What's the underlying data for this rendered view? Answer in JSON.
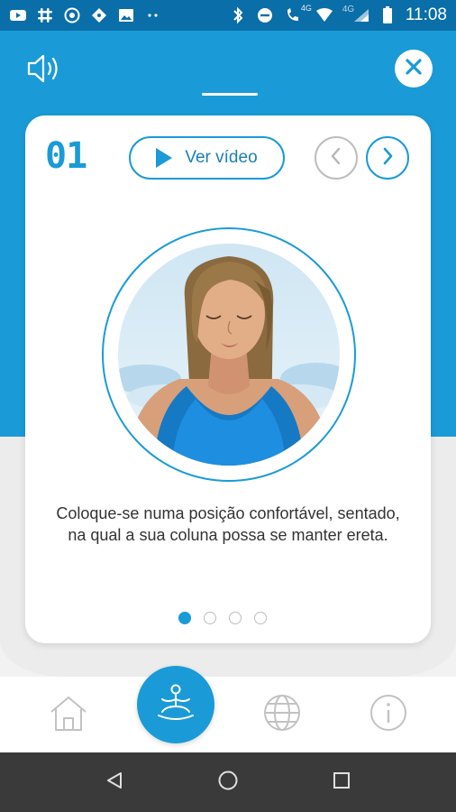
{
  "status_bar": {
    "time": "11:08",
    "network_label": "4G",
    "network_label_2": "4G",
    "icons_left": [
      "youtube-icon",
      "slack-icon",
      "whatsapp-icon",
      "ticket-icon",
      "gallery-icon",
      "more-dots-icon"
    ],
    "icons_right": [
      "bluetooth-icon",
      "do-not-disturb-icon",
      "phone-signal-icon",
      "wifi-icon",
      "cell-signal-icon",
      "battery-icon"
    ]
  },
  "header": {
    "sound_icon": "speaker-icon",
    "close_icon": "close-icon"
  },
  "card": {
    "step_number": "01",
    "video_button_label": "Ver vídeo",
    "prev_icon": "chevron-left-icon",
    "next_icon": "chevron-right-icon",
    "instruction": "Coloque-se numa posição confortável, sentado, na qual a sua coluna possa se manter ereta.",
    "pagination": {
      "total": 4,
      "active_index": 0
    }
  },
  "bottom_nav": {
    "items": [
      "home-icon",
      "meditation-icon",
      "globe-icon",
      "info-icon"
    ],
    "active": "meditation-icon"
  },
  "colors": {
    "primary": "#1a9bd7",
    "status_bar": "#0a6ea8",
    "system_nav": "#3a3a3a"
  }
}
